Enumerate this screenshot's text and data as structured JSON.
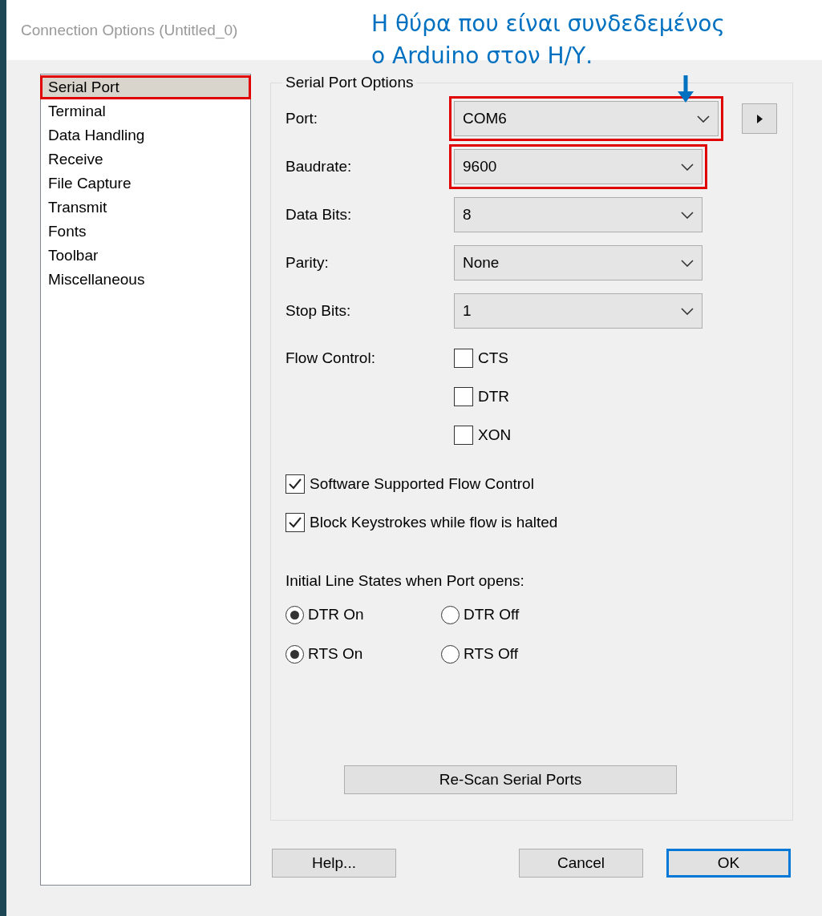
{
  "window": {
    "title": "Connection Options (Untitled_0)"
  },
  "annotation": {
    "lines": [
      "Η θύρα που είναι συνδεδεμένος",
      "ο Arduino στον Η/Υ."
    ]
  },
  "sidebar": {
    "items": [
      {
        "label": "Serial Port",
        "selected": true,
        "highlighted": true
      },
      {
        "label": "Terminal",
        "selected": false,
        "highlighted": false
      },
      {
        "label": "Data Handling",
        "selected": false,
        "highlighted": false
      },
      {
        "label": "Receive",
        "selected": false,
        "highlighted": false
      },
      {
        "label": "File Capture",
        "selected": false,
        "highlighted": false
      },
      {
        "label": "Transmit",
        "selected": false,
        "highlighted": false
      },
      {
        "label": "Fonts",
        "selected": false,
        "highlighted": false
      },
      {
        "label": "Toolbar",
        "selected": false,
        "highlighted": false
      },
      {
        "label": "Miscellaneous",
        "selected": false,
        "highlighted": false
      }
    ]
  },
  "group": {
    "title": "Serial Port Options",
    "fields": [
      {
        "label": "Port:",
        "value": "COM6",
        "highlighted": true,
        "side_button": true
      },
      {
        "label": "Baudrate:",
        "value": "9600",
        "highlighted": true,
        "side_button": false
      },
      {
        "label": "Data Bits:",
        "value": "8",
        "highlighted": false,
        "side_button": false
      },
      {
        "label": "Parity:",
        "value": "None",
        "highlighted": false,
        "side_button": false
      },
      {
        "label": "Stop Bits:",
        "value": "1",
        "highlighted": false,
        "side_button": false
      }
    ],
    "flow_control": {
      "label": "Flow Control:",
      "options": [
        {
          "label": "CTS",
          "checked": false
        },
        {
          "label": "DTR",
          "checked": false
        },
        {
          "label": "XON",
          "checked": false
        }
      ]
    },
    "options": [
      {
        "label": "Software Supported Flow Control",
        "checked": true
      },
      {
        "label": "Block Keystrokes while flow is halted",
        "checked": true
      }
    ],
    "line_states": {
      "label": "Initial Line States when Port opens:",
      "rows": [
        {
          "options": [
            {
              "label": "DTR On",
              "selected": true
            },
            {
              "label": "DTR Off",
              "selected": false
            }
          ]
        },
        {
          "options": [
            {
              "label": "RTS On",
              "selected": true
            },
            {
              "label": "RTS Off",
              "selected": false
            }
          ]
        }
      ]
    },
    "rescan_button": "Re-Scan Serial Ports"
  },
  "buttons": [
    {
      "label": "Help...",
      "default": false
    },
    {
      "label": "Cancel",
      "default": false
    },
    {
      "label": "OK",
      "default": true
    }
  ]
}
